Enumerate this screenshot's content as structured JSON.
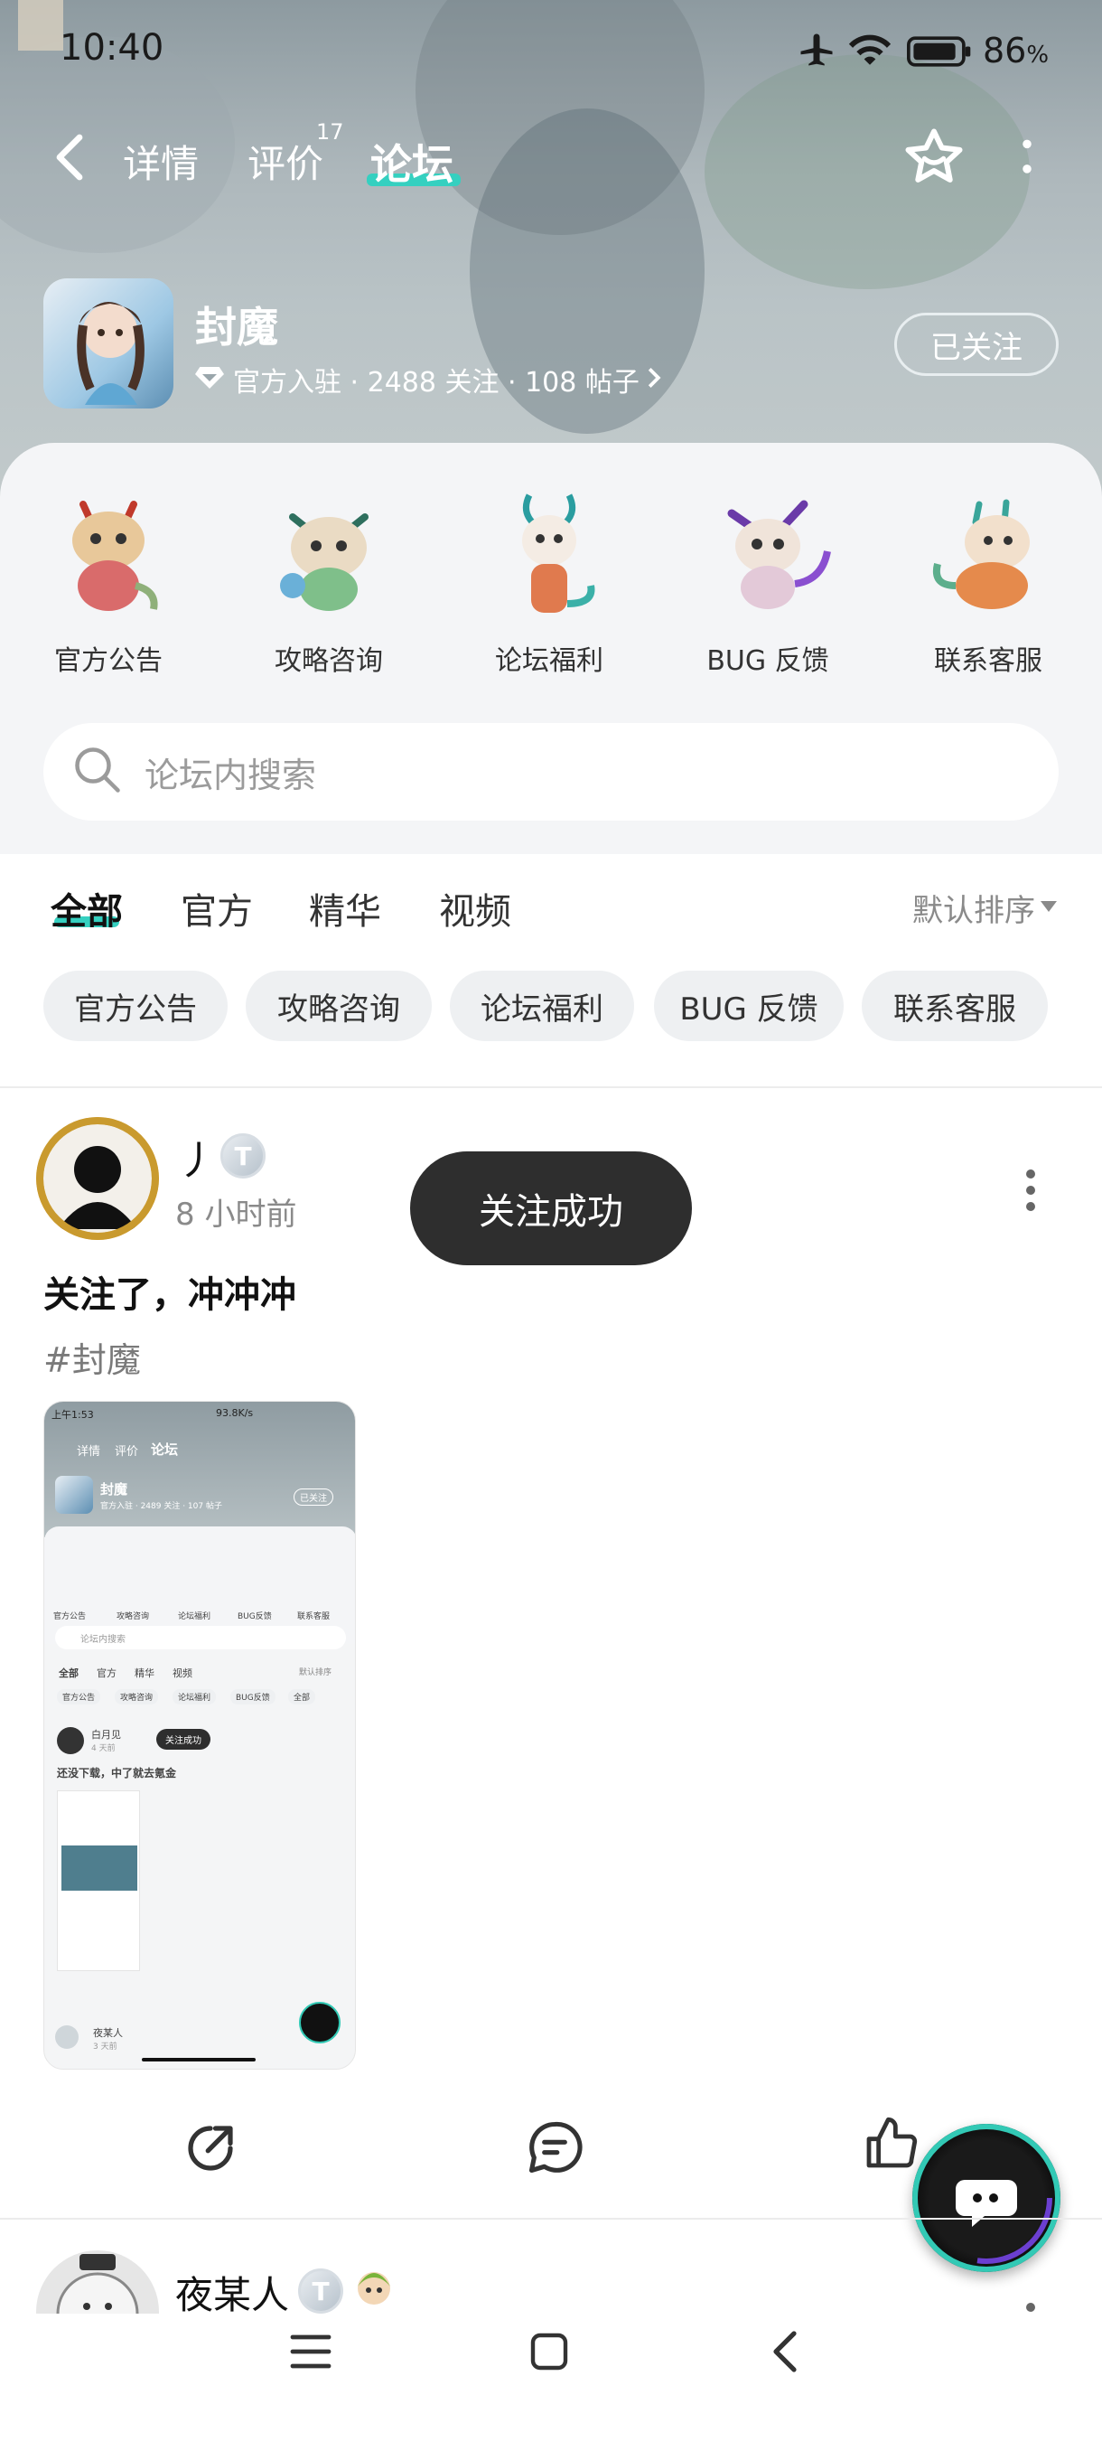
{
  "status_bar": {
    "time": "10:40",
    "battery": "86",
    "battery_unit": "%"
  },
  "nav": {
    "tabs": [
      {
        "label": "详情"
      },
      {
        "label": "评价",
        "badge": "17"
      },
      {
        "label": "论坛"
      }
    ],
    "active_tab": "论坛"
  },
  "game": {
    "name": "封魔",
    "meta": "官方入驻 · 2488 关注 · 108 帖子",
    "follow_label": "已关注"
  },
  "categories": [
    {
      "label": "官方公告"
    },
    {
      "label": "攻略咨询"
    },
    {
      "label": "论坛福利"
    },
    {
      "label": "BUG 反馈"
    },
    {
      "label": "联系客服"
    }
  ],
  "search": {
    "placeholder": "论坛内搜索"
  },
  "filter_tabs": [
    "全部",
    "官方",
    "精华",
    "视频"
  ],
  "sort_label": "默认排序",
  "chips": [
    "官方公告",
    "攻略咨询",
    "论坛福利",
    "BUG 反馈",
    "联系客服"
  ],
  "toast": "关注成功",
  "post": {
    "author": "丿",
    "time": "8 小时前",
    "title": "关注了，冲冲冲",
    "tag": "#封魔",
    "screenshot": {
      "status": "上午1:53",
      "status_right": "93.8K/s",
      "tabs": [
        "详情",
        "评价",
        "论坛"
      ],
      "name": "封魔",
      "meta": "官方入驻 · 2489 关注 · 107 帖子",
      "follow": "已关注",
      "cats": [
        "官方公告",
        "攻略咨询",
        "论坛福利",
        "BUG反馈",
        "联系客服"
      ],
      "search": "论坛内搜索",
      "tabs2": [
        "全部",
        "官方",
        "精华",
        "视频"
      ],
      "sort": "默认排序",
      "chips": [
        "官方公告",
        "攻略咨询",
        "论坛福利",
        "BUG反馈",
        "全部"
      ],
      "author": "白月见",
      "time": "4 天前",
      "toast": "关注成功",
      "title": "还没下载，中了就去氪金",
      "author2": "夜某人",
      "time2": "3 天前"
    }
  },
  "post2": {
    "author": "夜某人"
  },
  "colors": {
    "accent": "#35d0c0",
    "toast_bg": "#2e2e2e",
    "panel_bg": "#f4f5f7"
  }
}
